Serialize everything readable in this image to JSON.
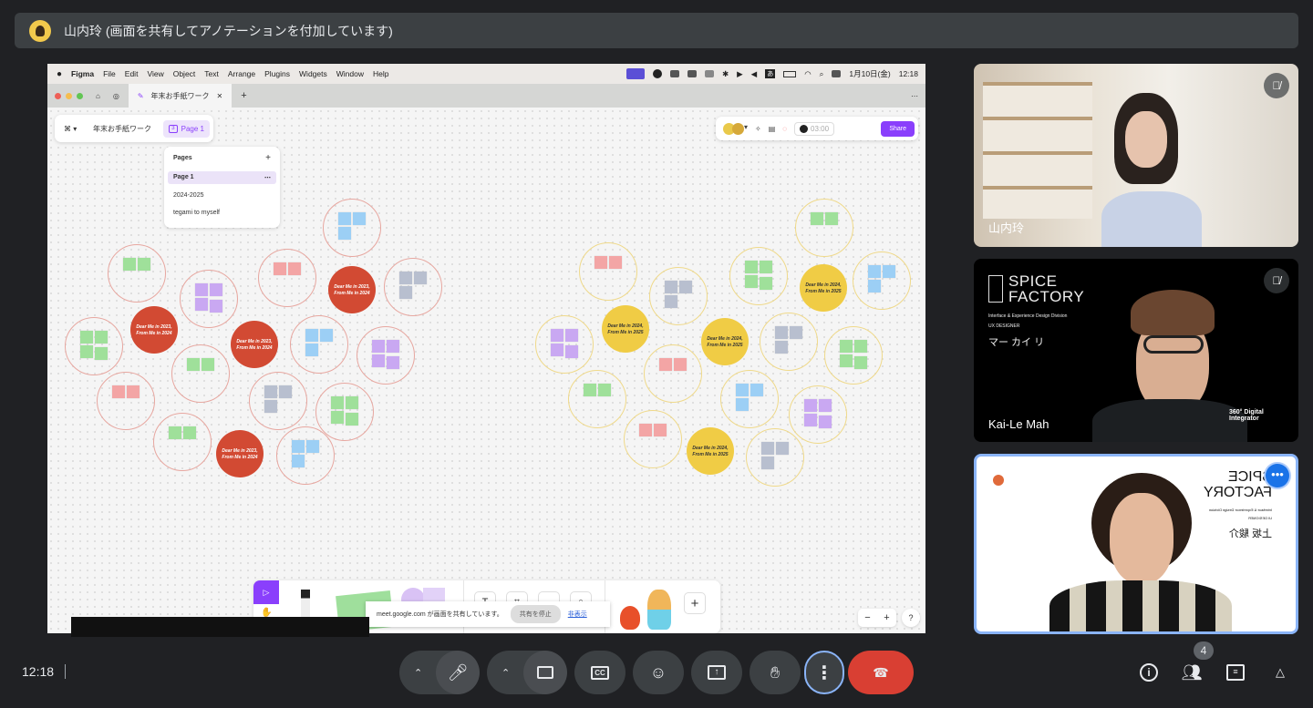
{
  "presenter": {
    "label": "山内玲 (画面を共有してアノテーションを付加しています)"
  },
  "mac_menubar": {
    "app": "Figma",
    "items": [
      "File",
      "Edit",
      "View",
      "Object",
      "Text",
      "Arrange",
      "Plugins",
      "Widgets",
      "Window",
      "Help"
    ],
    "ime": "あ",
    "datetime": "1月10日(金)",
    "time": "12:18"
  },
  "figma": {
    "tab_title": "年末お手紙ワーク",
    "file_name": "年末お手紙ワーク",
    "page_button": "Page 1",
    "page_count": "3",
    "pages_header": "Pages",
    "pages": [
      "Page 1",
      "2024-2025",
      "tegami to myself"
    ],
    "timer": "03:00",
    "share_label": "Share",
    "circle_red_text": [
      "Dear Me in 2023,",
      "From Me in 2024"
    ],
    "circle_yellow_text": [
      "Dear Me in 2024,",
      "From Me in 2025"
    ],
    "share_notice": "meet.google.com が画面を共有しています。",
    "stop_sharing": "共有を停止",
    "hide": "非表示",
    "help": "?"
  },
  "participants": [
    {
      "name": "山内玲",
      "muted": true
    },
    {
      "name": "Kai-Le Mah",
      "muted": true,
      "bg_brand": [
        "SPICE",
        "FACTORY"
      ],
      "bg_division": "Interface & Experience Design Division",
      "bg_role": "UX DESIGNER",
      "bg_name": "マー カイ リ",
      "bg_badge": "360° Digital Integrator"
    },
    {
      "name": "上坂 駿介",
      "bg_brand": [
        "SPICE",
        "FACTORY"
      ],
      "bg_division": "Interface & Experience Design Division",
      "bg_role": "UI DESIGNER"
    }
  ],
  "meet_controls": {
    "clock": "12:18",
    "participant_count": "4"
  },
  "colors": {
    "meet_bg": "#202124",
    "hangup": "#d93f33",
    "figma_purple": "#8a3ffc",
    "red_circle": "#d24a33",
    "yellow_circle": "#f0cc45"
  }
}
